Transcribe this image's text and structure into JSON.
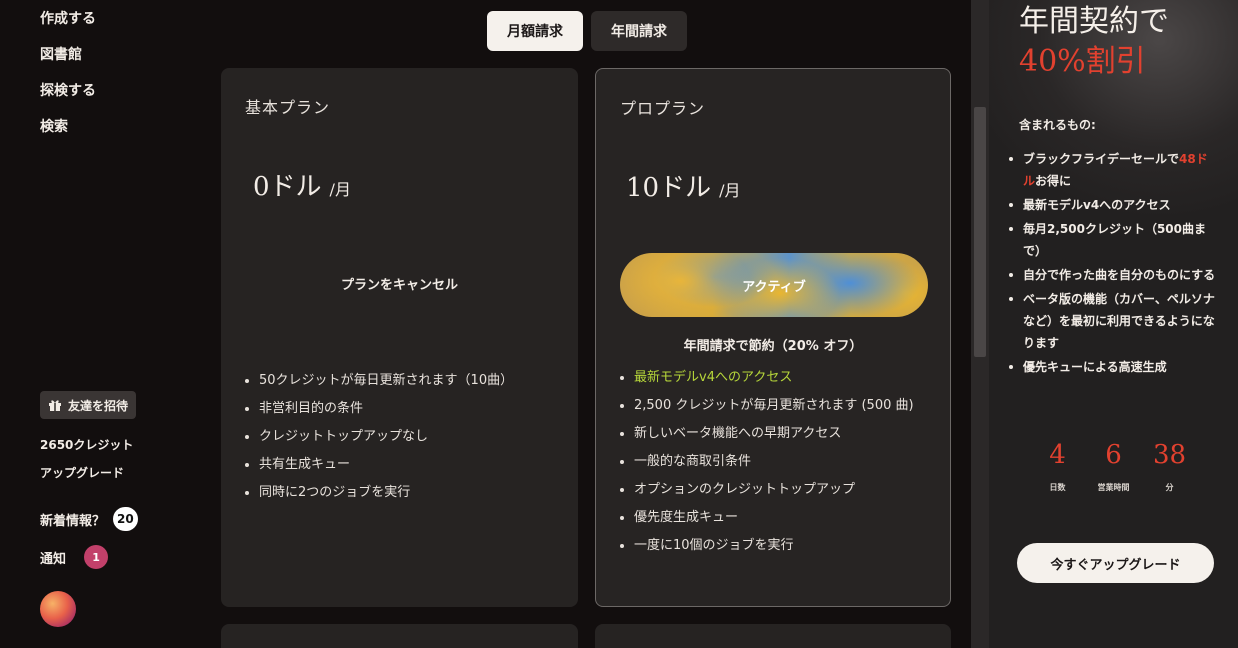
{
  "sidebar": {
    "nav": [
      "作成する",
      "図書館",
      "探検する",
      "検索"
    ],
    "invite_label": "友達を招待",
    "credits": "2650クレジット",
    "upgrade": "アップグレード",
    "whats_new": {
      "label": "新着情報？",
      "count": "20"
    },
    "notifications": {
      "label": "通知",
      "count": "1"
    }
  },
  "billing_toggle": {
    "monthly": "月額請求",
    "yearly": "年間請求",
    "selected": "monthly"
  },
  "plans": {
    "basic": {
      "name": "基本プラン",
      "price": "0ドル",
      "unit": "/月",
      "action": "プランをキャンセル",
      "features": [
        "50クレジットが毎日更新されます（10曲）",
        "非営利目的の条件",
        "クレジットトップアップなし",
        "共有生成キュー",
        "同時に2つのジョブを実行"
      ]
    },
    "pro": {
      "name": "プロプラン",
      "price": "10ドル",
      "unit": "/月",
      "action": "アクティブ",
      "note": "年間請求で節約（20% オフ）",
      "features": [
        "最新モデルv4へのアクセス",
        "2,500 クレジットが毎月更新されます (500 曲)",
        "新しいベータ機能への早期アクセス",
        "一般的な商取引条件",
        "オプションのクレジットトップアップ",
        "優先度生成キュー",
        "一度に10個のジョブを実行"
      ],
      "highlight_color": "#b6d63a"
    }
  },
  "promo": {
    "title": "年間契約で",
    "discount": "40%割引",
    "included_label": "含まれるもの:",
    "items": [
      {
        "pre": "ブラックフライデーセールで",
        "red": "48ドル",
        "post": "お得に"
      },
      {
        "pre": "最新モデルv4へのアクセス",
        "red": "",
        "post": ""
      },
      {
        "pre": "毎月2,500クレジット（500曲まで）",
        "red": "",
        "post": ""
      },
      {
        "pre": "自分で作った曲を自分のものにする",
        "red": "",
        "post": ""
      },
      {
        "pre": "ベータ版の機能（カバー、ペルソナなど）を最初に利用できるようになります",
        "red": "",
        "post": ""
      },
      {
        "pre": "優先キューによる高速生成",
        "red": "",
        "post": ""
      }
    ],
    "countdown": [
      {
        "value": "4",
        "label": "日数"
      },
      {
        "value": "6",
        "label": "営業時間"
      },
      {
        "value": "38",
        "label": "分"
      }
    ],
    "cta": "今すぐアップグレード",
    "accent": "#e2412f"
  }
}
